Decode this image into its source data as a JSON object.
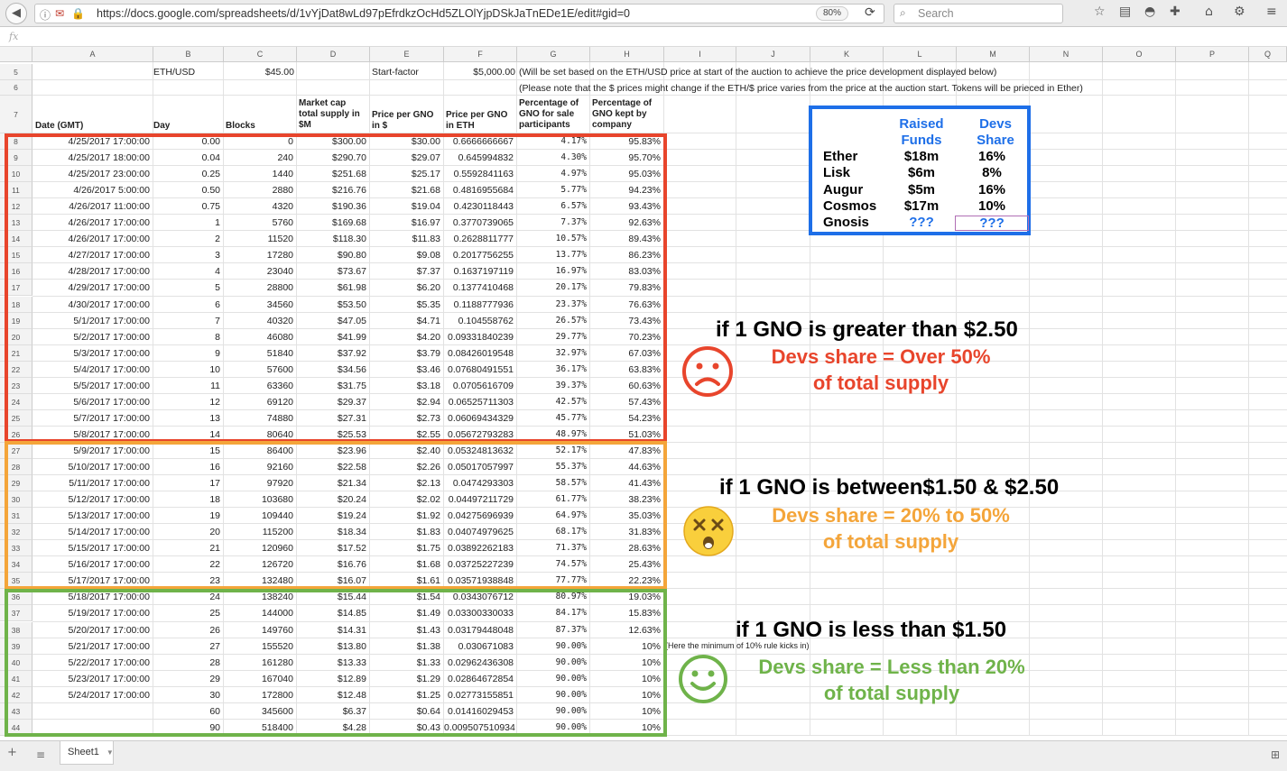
{
  "browser": {
    "url": "https://docs.google.com/spreadsheets/d/1vYjDat8wLd97pEfrdkzOcHd5ZLOlYjpDSkJaTnEDe1E/edit#gid=0",
    "zoom": "80%",
    "search_placeholder": "Search"
  },
  "formula_bar": {
    "fx": "fx"
  },
  "columns": [
    "A",
    "B",
    "C",
    "D",
    "E",
    "F",
    "G",
    "H",
    "I",
    "J",
    "K",
    "L",
    "M",
    "N",
    "O",
    "P",
    "Q"
  ],
  "row5": {
    "label": "ETH/USD",
    "value": "$45.00",
    "start_label": "Start-factor",
    "start_value": "$5,000.00",
    "note": "(Will be set based on the ETH/USD price at start of the auction to achieve the price development displayed below)"
  },
  "row6": {
    "note": "(Please note that the $ prices might change if the ETH/$ price varies from the price at the auction start. Tokens will be prieced in Ether)"
  },
  "headers": {
    "date": "Date (GMT)",
    "day": "Day",
    "blocks": "Blocks",
    "market_cap": [
      "Market cap",
      "total supply in",
      "$M"
    ],
    "price_usd": [
      "Price per GNO",
      "in $"
    ],
    "price_eth": [
      "Price per GNO",
      "in ETH"
    ],
    "pct_sale": [
      "Percentage of",
      "GNO for sale",
      "participants"
    ],
    "pct_kept": [
      "Percentage of",
      "GNO kept by",
      "company"
    ]
  },
  "rows": [
    {
      "n": "8",
      "date": "4/25/2017 17:00:00",
      "day": "0.00",
      "blocks": "0",
      "mcap": "$300.00",
      "usd": "$30.00",
      "eth": "0.6666666667",
      "sale": "4.17%",
      "kept": "95.83%"
    },
    {
      "n": "9",
      "date": "4/25/2017 18:00:00",
      "day": "0.04",
      "blocks": "240",
      "mcap": "$290.70",
      "usd": "$29.07",
      "eth": "0.645994832",
      "sale": "4.30%",
      "kept": "95.70%"
    },
    {
      "n": "10",
      "date": "4/25/2017 23:00:00",
      "day": "0.25",
      "blocks": "1440",
      "mcap": "$251.68",
      "usd": "$25.17",
      "eth": "0.5592841163",
      "sale": "4.97%",
      "kept": "95.03%"
    },
    {
      "n": "11",
      "date": "4/26/2017 5:00:00",
      "day": "0.50",
      "blocks": "2880",
      "mcap": "$216.76",
      "usd": "$21.68",
      "eth": "0.4816955684",
      "sale": "5.77%",
      "kept": "94.23%"
    },
    {
      "n": "12",
      "date": "4/26/2017 11:00:00",
      "day": "0.75",
      "blocks": "4320",
      "mcap": "$190.36",
      "usd": "$19.04",
      "eth": "0.4230118443",
      "sale": "6.57%",
      "kept": "93.43%"
    },
    {
      "n": "13",
      "date": "4/26/2017 17:00:00",
      "day": "1",
      "blocks": "5760",
      "mcap": "$169.68",
      "usd": "$16.97",
      "eth": "0.3770739065",
      "sale": "7.37%",
      "kept": "92.63%"
    },
    {
      "n": "14",
      "date": "4/26/2017 17:00:00",
      "day": "2",
      "blocks": "11520",
      "mcap": "$118.30",
      "usd": "$11.83",
      "eth": "0.2628811777",
      "sale": "10.57%",
      "kept": "89.43%"
    },
    {
      "n": "15",
      "date": "4/27/2017 17:00:00",
      "day": "3",
      "blocks": "17280",
      "mcap": "$90.80",
      "usd": "$9.08",
      "eth": "0.2017756255",
      "sale": "13.77%",
      "kept": "86.23%"
    },
    {
      "n": "16",
      "date": "4/28/2017 17:00:00",
      "day": "4",
      "blocks": "23040",
      "mcap": "$73.67",
      "usd": "$7.37",
      "eth": "0.1637197119",
      "sale": "16.97%",
      "kept": "83.03%"
    },
    {
      "n": "17",
      "date": "4/29/2017 17:00:00",
      "day": "5",
      "blocks": "28800",
      "mcap": "$61.98",
      "usd": "$6.20",
      "eth": "0.1377410468",
      "sale": "20.17%",
      "kept": "79.83%"
    },
    {
      "n": "18",
      "date": "4/30/2017 17:00:00",
      "day": "6",
      "blocks": "34560",
      "mcap": "$53.50",
      "usd": "$5.35",
      "eth": "0.1188777936",
      "sale": "23.37%",
      "kept": "76.63%"
    },
    {
      "n": "19",
      "date": "5/1/2017 17:00:00",
      "day": "7",
      "blocks": "40320",
      "mcap": "$47.05",
      "usd": "$4.71",
      "eth": "0.104558762",
      "sale": "26.57%",
      "kept": "73.43%"
    },
    {
      "n": "20",
      "date": "5/2/2017 17:00:00",
      "day": "8",
      "blocks": "46080",
      "mcap": "$41.99",
      "usd": "$4.20",
      "eth": "0.09331840239",
      "sale": "29.77%",
      "kept": "70.23%"
    },
    {
      "n": "21",
      "date": "5/3/2017 17:00:00",
      "day": "9",
      "blocks": "51840",
      "mcap": "$37.92",
      "usd": "$3.79",
      "eth": "0.08426019548",
      "sale": "32.97%",
      "kept": "67.03%"
    },
    {
      "n": "22",
      "date": "5/4/2017 17:00:00",
      "day": "10",
      "blocks": "57600",
      "mcap": "$34.56",
      "usd": "$3.46",
      "eth": "0.07680491551",
      "sale": "36.17%",
      "kept": "63.83%"
    },
    {
      "n": "23",
      "date": "5/5/2017 17:00:00",
      "day": "11",
      "blocks": "63360",
      "mcap": "$31.75",
      "usd": "$3.18",
      "eth": "0.0705616709",
      "sale": "39.37%",
      "kept": "60.63%"
    },
    {
      "n": "24",
      "date": "5/6/2017 17:00:00",
      "day": "12",
      "blocks": "69120",
      "mcap": "$29.37",
      "usd": "$2.94",
      "eth": "0.06525711303",
      "sale": "42.57%",
      "kept": "57.43%"
    },
    {
      "n": "25",
      "date": "5/7/2017 17:00:00",
      "day": "13",
      "blocks": "74880",
      "mcap": "$27.31",
      "usd": "$2.73",
      "eth": "0.06069434329",
      "sale": "45.77%",
      "kept": "54.23%"
    },
    {
      "n": "26",
      "date": "5/8/2017 17:00:00",
      "day": "14",
      "blocks": "80640",
      "mcap": "$25.53",
      "usd": "$2.55",
      "eth": "0.05672793283",
      "sale": "48.97%",
      "kept": "51.03%"
    },
    {
      "n": "27",
      "date": "5/9/2017 17:00:00",
      "day": "15",
      "blocks": "86400",
      "mcap": "$23.96",
      "usd": "$2.40",
      "eth": "0.05324813632",
      "sale": "52.17%",
      "kept": "47.83%"
    },
    {
      "n": "28",
      "date": "5/10/2017 17:00:00",
      "day": "16",
      "blocks": "92160",
      "mcap": "$22.58",
      "usd": "$2.26",
      "eth": "0.05017057997",
      "sale": "55.37%",
      "kept": "44.63%"
    },
    {
      "n": "29",
      "date": "5/11/2017 17:00:00",
      "day": "17",
      "blocks": "97920",
      "mcap": "$21.34",
      "usd": "$2.13",
      "eth": "0.0474293303",
      "sale": "58.57%",
      "kept": "41.43%"
    },
    {
      "n": "30",
      "date": "5/12/2017 17:00:00",
      "day": "18",
      "blocks": "103680",
      "mcap": "$20.24",
      "usd": "$2.02",
      "eth": "0.04497211729",
      "sale": "61.77%",
      "kept": "38.23%"
    },
    {
      "n": "31",
      "date": "5/13/2017 17:00:00",
      "day": "19",
      "blocks": "109440",
      "mcap": "$19.24",
      "usd": "$1.92",
      "eth": "0.04275696939",
      "sale": "64.97%",
      "kept": "35.03%"
    },
    {
      "n": "32",
      "date": "5/14/2017 17:00:00",
      "day": "20",
      "blocks": "115200",
      "mcap": "$18.34",
      "usd": "$1.83",
      "eth": "0.04074979625",
      "sale": "68.17%",
      "kept": "31.83%"
    },
    {
      "n": "33",
      "date": "5/15/2017 17:00:00",
      "day": "21",
      "blocks": "120960",
      "mcap": "$17.52",
      "usd": "$1.75",
      "eth": "0.03892262183",
      "sale": "71.37%",
      "kept": "28.63%"
    },
    {
      "n": "34",
      "date": "5/16/2017 17:00:00",
      "day": "22",
      "blocks": "126720",
      "mcap": "$16.76",
      "usd": "$1.68",
      "eth": "0.03725227239",
      "sale": "74.57%",
      "kept": "25.43%"
    },
    {
      "n": "35",
      "date": "5/17/2017 17:00:00",
      "day": "23",
      "blocks": "132480",
      "mcap": "$16.07",
      "usd": "$1.61",
      "eth": "0.03571938848",
      "sale": "77.77%",
      "kept": "22.23%"
    },
    {
      "n": "36",
      "date": "5/18/2017 17:00:00",
      "day": "24",
      "blocks": "138240",
      "mcap": "$15.44",
      "usd": "$1.54",
      "eth": "0.0343076712",
      "sale": "80.97%",
      "kept": "19.03%"
    },
    {
      "n": "37",
      "date": "5/19/2017 17:00:00",
      "day": "25",
      "blocks": "144000",
      "mcap": "$14.85",
      "usd": "$1.49",
      "eth": "0.03300330033",
      "sale": "84.17%",
      "kept": "15.83%"
    },
    {
      "n": "38",
      "date": "5/20/2017 17:00:00",
      "day": "26",
      "blocks": "149760",
      "mcap": "$14.31",
      "usd": "$1.43",
      "eth": "0.03179448048",
      "sale": "87.37%",
      "kept": "12.63%"
    },
    {
      "n": "39",
      "date": "5/21/2017 17:00:00",
      "day": "27",
      "blocks": "155520",
      "mcap": "$13.80",
      "usd": "$1.38",
      "eth": "0.030671083",
      "sale": "90.00%",
      "kept": "10%"
    },
    {
      "n": "40",
      "date": "5/22/2017 17:00:00",
      "day": "28",
      "blocks": "161280",
      "mcap": "$13.33",
      "usd": "$1.33",
      "eth": "0.02962436308",
      "sale": "90.00%",
      "kept": "10%"
    },
    {
      "n": "41",
      "date": "5/23/2017 17:00:00",
      "day": "29",
      "blocks": "167040",
      "mcap": "$12.89",
      "usd": "$1.29",
      "eth": "0.02864672854",
      "sale": "90.00%",
      "kept": "10%"
    },
    {
      "n": "42",
      "date": "5/24/2017 17:00:00",
      "day": "30",
      "blocks": "172800",
      "mcap": "$12.48",
      "usd": "$1.25",
      "eth": "0.02773155851",
      "sale": "90.00%",
      "kept": "10%"
    },
    {
      "n": "43",
      "date": "",
      "day": "60",
      "blocks": "345600",
      "mcap": "$6.37",
      "usd": "$0.64",
      "eth": "0.01416029453",
      "sale": "90.00%",
      "kept": "10%"
    },
    {
      "n": "44",
      "date": "",
      "day": "90",
      "blocks": "518400",
      "mcap": "$4.28",
      "usd": "$0.43",
      "eth": "0.009507510934",
      "sale": "90.00%",
      "kept": "10%"
    }
  ],
  "min_rule_note": "(Here the minimum of 10% rule kicks in)",
  "comparison": {
    "header_funds": [
      "Raised",
      "Funds"
    ],
    "header_share": [
      "Devs",
      "Share"
    ],
    "rows": [
      {
        "name": "Ether",
        "funds": "$18m",
        "share": "16%"
      },
      {
        "name": "Lisk",
        "funds": "$6m",
        "share": "8%"
      },
      {
        "name": "Augur",
        "funds": "$5m",
        "share": "16%"
      },
      {
        "name": "Cosmos",
        "funds": "$17m",
        "share": "10%"
      },
      {
        "name": "Gnosis",
        "funds": "???",
        "share": "???"
      }
    ]
  },
  "annotations": {
    "red": {
      "headline": "if 1 GNO is greater than $2.50",
      "line1": "Devs share = Over 50%",
      "line2": "of total supply",
      "color": "#e8452c"
    },
    "orange": {
      "headline": "if 1 GNO is between$1.50 & $2.50",
      "line1": "Devs share = 20% to 50%",
      "line2": "of total supply",
      "color": "#f4a53a"
    },
    "green": {
      "headline": "if 1 GNO is less than $1.50",
      "line1": "Devs share = Less than 20%",
      "line2": "of total supply",
      "color": "#6fb34a"
    }
  },
  "sheet": {
    "tab": "Sheet1"
  },
  "colors": {
    "red_zone": "#e8452c",
    "orange_zone": "#f4a53a",
    "green_zone": "#6fb34a",
    "compare_border": "#1e6fe8"
  }
}
